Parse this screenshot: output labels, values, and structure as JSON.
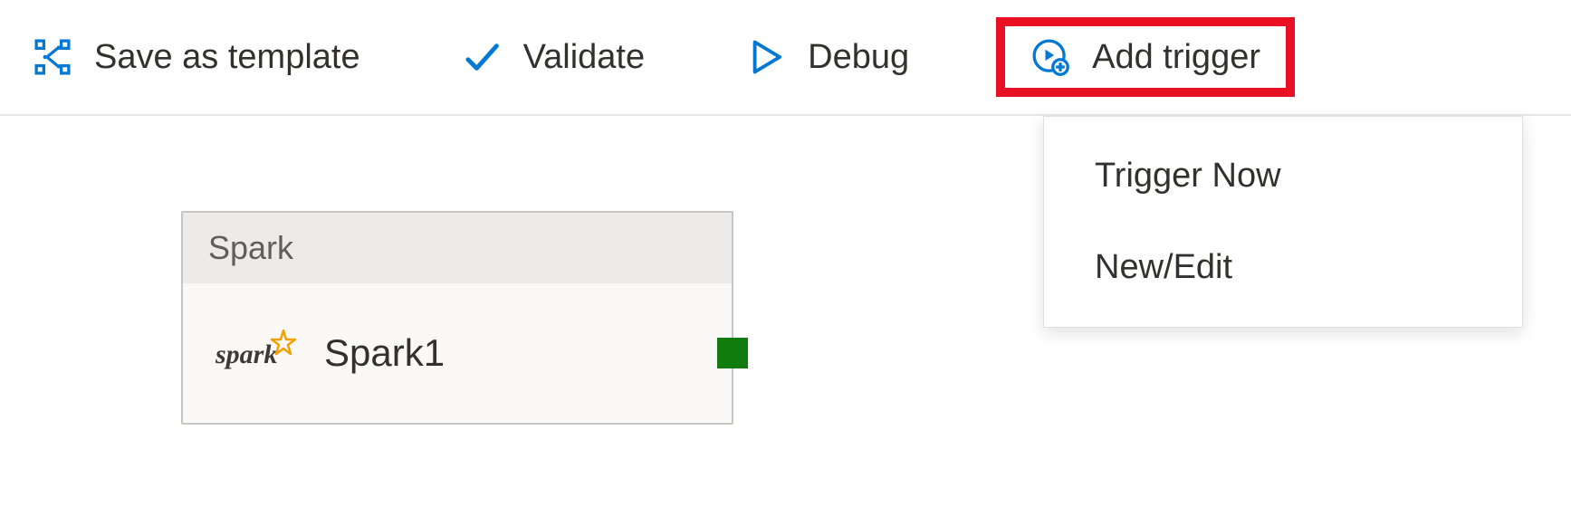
{
  "toolbar": {
    "save_as_template": "Save as template",
    "validate": "Validate",
    "debug": "Debug",
    "add_trigger": "Add trigger"
  },
  "activity": {
    "type_label": "Spark",
    "name": "Spark1"
  },
  "dropdown": {
    "items": [
      "Trigger Now",
      "New/Edit"
    ]
  },
  "colors": {
    "accent": "#0078d4",
    "highlight": "#e81123",
    "success": "#107c10",
    "spark_star": "#f2a100"
  }
}
